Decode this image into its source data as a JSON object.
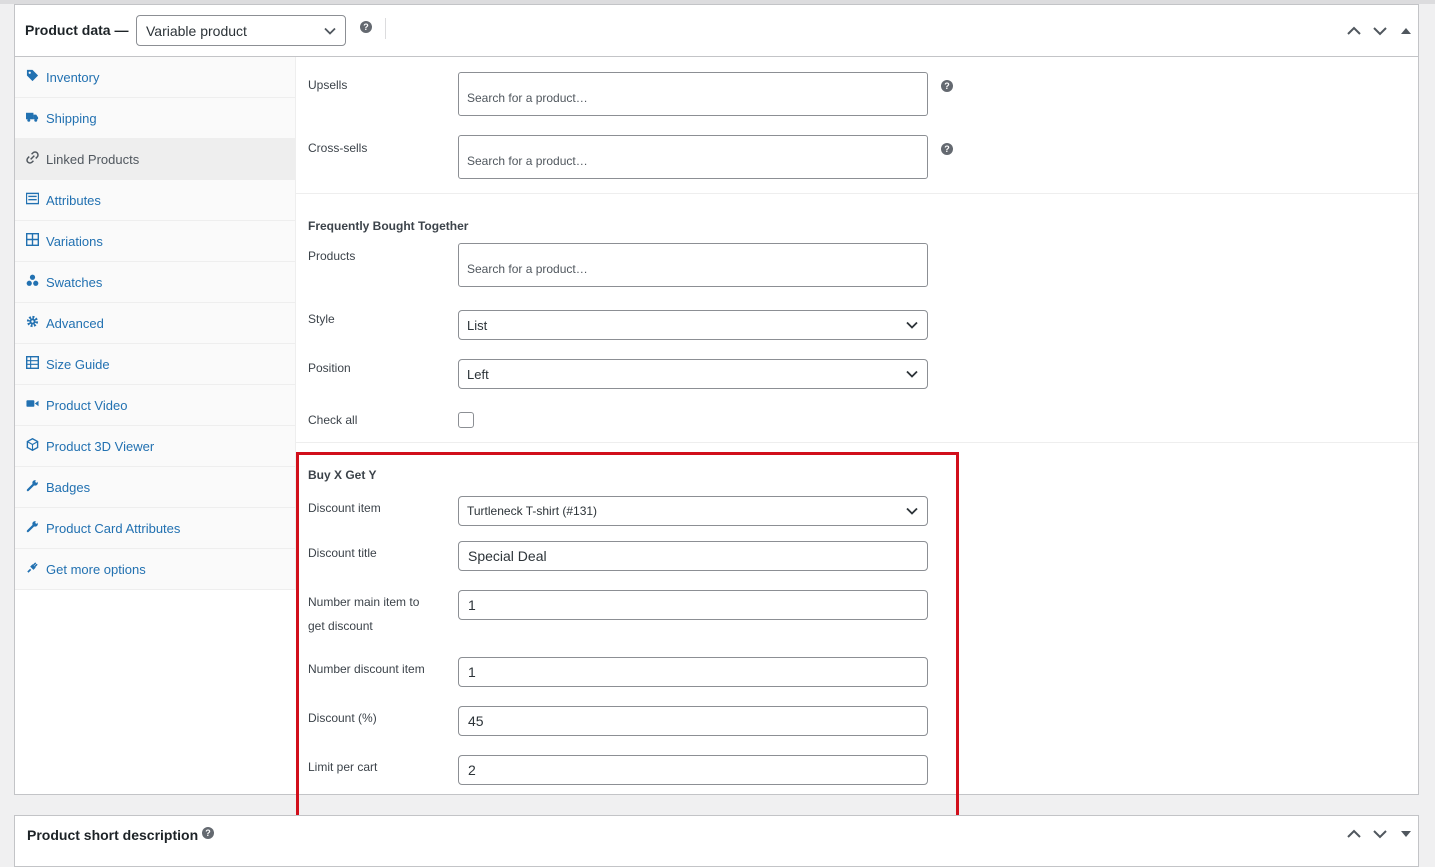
{
  "product_data": {
    "title": "Product data —",
    "product_type": "Variable product",
    "help": "?"
  },
  "tabs": [
    {
      "label": "Inventory",
      "icon": "tag-icon"
    },
    {
      "label": "Shipping",
      "icon": "truck-icon"
    },
    {
      "label": "Linked Products",
      "icon": "link-icon",
      "active": true
    },
    {
      "label": "Attributes",
      "icon": "list-icon"
    },
    {
      "label": "Variations",
      "icon": "grid-icon"
    },
    {
      "label": "Swatches",
      "icon": "swatches-icon"
    },
    {
      "label": "Advanced",
      "icon": "gear-icon"
    },
    {
      "label": "Size Guide",
      "icon": "table-icon"
    },
    {
      "label": "Product Video",
      "icon": "video-icon"
    },
    {
      "label": "Product 3D Viewer",
      "icon": "cube-icon"
    },
    {
      "label": "Badges",
      "icon": "wrench-icon"
    },
    {
      "label": "Product Card Attributes",
      "icon": "wrench-icon"
    },
    {
      "label": "Get more options",
      "icon": "plug-icon"
    }
  ],
  "linked": {
    "upsells_label": "Upsells",
    "upsells_placeholder": "Search for a product…",
    "crosssells_label": "Cross-sells",
    "crosssells_placeholder": "Search for a product…"
  },
  "fbt": {
    "heading": "Frequently Bought Together",
    "products_label": "Products",
    "products_placeholder": "Search for a product…",
    "style_label": "Style",
    "style_value": "List",
    "position_label": "Position",
    "position_value": "Left",
    "checkall_label": "Check all"
  },
  "bxgy": {
    "heading": "Buy X Get Y",
    "discount_item_label": "Discount item",
    "discount_item_value": "Turtleneck T-shirt (#131)",
    "discount_title_label": "Discount title",
    "discount_title_value": "Special Deal",
    "number_main_label_1": "Number main item to",
    "number_main_label_2": "get discount",
    "number_main_value": "1",
    "number_discount_label": "Number discount item",
    "number_discount_value": "1",
    "discount_pct_label": "Discount (%)",
    "discount_pct_value": "45",
    "limit_label": "Limit per cart",
    "limit_value": "2"
  },
  "short_description": {
    "title": "Product short description",
    "help": "?"
  },
  "colors": {
    "link": "#2271b1",
    "highlight": "#d10f1b",
    "border": "#c3c4c7"
  }
}
